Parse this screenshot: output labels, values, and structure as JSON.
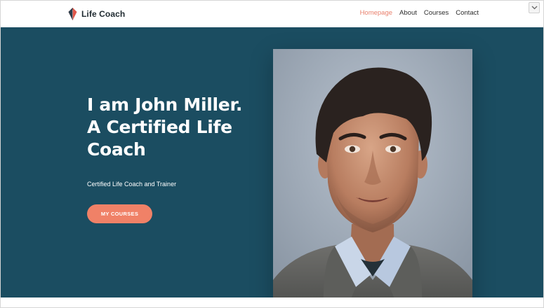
{
  "brand": {
    "name": "Life Coach",
    "logo_icon": "leaf-logo-icon"
  },
  "nav": {
    "items": [
      {
        "label": "Homepage",
        "active": true
      },
      {
        "label": "About",
        "active": false
      },
      {
        "label": "Courses",
        "active": false
      },
      {
        "label": "Contact",
        "active": false
      }
    ]
  },
  "hero": {
    "title": "I am John Miller. A Certified Life Coach",
    "subtitle": "Certified Life Coach and Trainer",
    "cta_label": "MY COURSES"
  },
  "colors": {
    "hero_bg": "#1b4d61",
    "accent": "#f08167",
    "nav_active": "#e9806d"
  }
}
